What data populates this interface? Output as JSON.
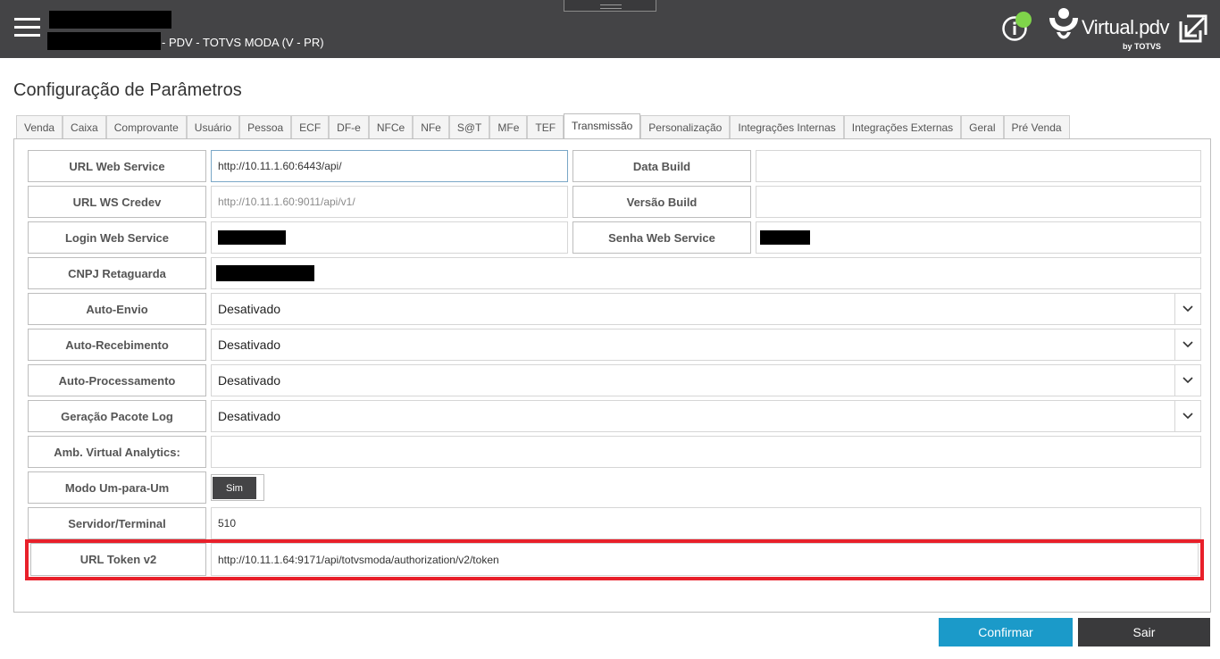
{
  "header": {
    "app_subtitle": "- PDV - TOTVS MODA (V - PR)",
    "logo_text": "Virtual.pdv",
    "logo_by": "by TOTVS",
    "icons": {
      "menu": "hamburger-menu-icon",
      "info": "info-icon",
      "status": "online-status-dot",
      "exit": "exit-window-icon"
    },
    "status_color": "#7fd44a"
  },
  "page": {
    "title": "Configuração de Parâmetros"
  },
  "tabs": [
    {
      "label": "Venda"
    },
    {
      "label": "Caixa"
    },
    {
      "label": "Comprovante"
    },
    {
      "label": "Usuário"
    },
    {
      "label": "Pessoa"
    },
    {
      "label": "ECF"
    },
    {
      "label": "DF-e"
    },
    {
      "label": "NFCe"
    },
    {
      "label": "NFe"
    },
    {
      "label": "S@T"
    },
    {
      "label": "MFe"
    },
    {
      "label": "TEF"
    },
    {
      "label": "Transmissão"
    },
    {
      "label": "Personalização"
    },
    {
      "label": "Integrações Internas"
    },
    {
      "label": "Integrações Externas"
    },
    {
      "label": "Geral"
    },
    {
      "label": "Pré Venda"
    }
  ],
  "active_tab": "Transmissão",
  "fields": {
    "url_web_service": {
      "label": "URL Web Service",
      "value": "http://10.11.1.60:6443/api/"
    },
    "data_build": {
      "label": "Data Build",
      "value": ""
    },
    "url_ws_credev": {
      "label": "URL WS Credev",
      "value": "http://10.11.1.60:9011/api/v1/"
    },
    "versao_build": {
      "label": "Versão Build",
      "value": ""
    },
    "login_web_service": {
      "label": "Login Web Service"
    },
    "senha_web_service": {
      "label": "Senha Web Service"
    },
    "cnpj_retaguarda": {
      "label": "CNPJ Retaguarda"
    },
    "auto_envio": {
      "label": "Auto-Envio",
      "value": "Desativado"
    },
    "auto_recebimento": {
      "label": "Auto-Recebimento",
      "value": "Desativado"
    },
    "auto_processamento": {
      "label": "Auto-Processamento",
      "value": "Desativado"
    },
    "geracao_pacote_log": {
      "label": "Geração Pacote Log",
      "value": "Desativado"
    },
    "amb_virtual_analytics": {
      "label": "Amb. Virtual Analytics:",
      "value": ""
    },
    "modo_um_para_um": {
      "label": "Modo Um-para-Um",
      "value": "Sim"
    },
    "servidor_terminal": {
      "label": "Servidor/Terminal",
      "value": "510"
    },
    "url_token_v2": {
      "label": "URL Token v2",
      "value": "http://10.11.1.64:9171/api/totvsmoda/authorization/v2/token"
    }
  },
  "colors": {
    "highlight": "#e8202a",
    "confirm": "#1b9ac9",
    "topbar": "#444446"
  },
  "buttons": {
    "confirm": "Confirmar",
    "exit": "Sair"
  }
}
